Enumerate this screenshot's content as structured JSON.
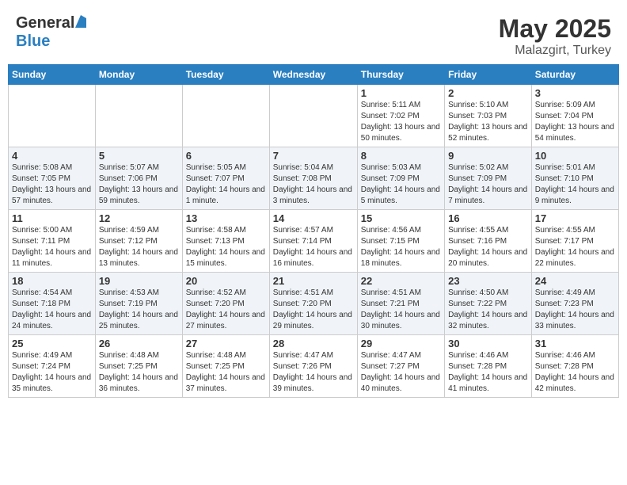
{
  "header": {
    "logo_general": "General",
    "logo_blue": "Blue",
    "title": "May 2025",
    "location": "Malazgirt, Turkey"
  },
  "weekdays": [
    "Sunday",
    "Monday",
    "Tuesday",
    "Wednesday",
    "Thursday",
    "Friday",
    "Saturday"
  ],
  "weeks": [
    [
      {
        "day": "",
        "sunrise": "",
        "sunset": "",
        "daylight": ""
      },
      {
        "day": "",
        "sunrise": "",
        "sunset": "",
        "daylight": ""
      },
      {
        "day": "",
        "sunrise": "",
        "sunset": "",
        "daylight": ""
      },
      {
        "day": "",
        "sunrise": "",
        "sunset": "",
        "daylight": ""
      },
      {
        "day": "1",
        "sunrise": "5:11 AM",
        "sunset": "7:02 PM",
        "daylight": "13 hours and 50 minutes."
      },
      {
        "day": "2",
        "sunrise": "5:10 AM",
        "sunset": "7:03 PM",
        "daylight": "13 hours and 52 minutes."
      },
      {
        "day": "3",
        "sunrise": "5:09 AM",
        "sunset": "7:04 PM",
        "daylight": "13 hours and 54 minutes."
      }
    ],
    [
      {
        "day": "4",
        "sunrise": "5:08 AM",
        "sunset": "7:05 PM",
        "daylight": "13 hours and 57 minutes."
      },
      {
        "day": "5",
        "sunrise": "5:07 AM",
        "sunset": "7:06 PM",
        "daylight": "13 hours and 59 minutes."
      },
      {
        "day": "6",
        "sunrise": "5:05 AM",
        "sunset": "7:07 PM",
        "daylight": "14 hours and 1 minute."
      },
      {
        "day": "7",
        "sunrise": "5:04 AM",
        "sunset": "7:08 PM",
        "daylight": "14 hours and 3 minutes."
      },
      {
        "day": "8",
        "sunrise": "5:03 AM",
        "sunset": "7:09 PM",
        "daylight": "14 hours and 5 minutes."
      },
      {
        "day": "9",
        "sunrise": "5:02 AM",
        "sunset": "7:09 PM",
        "daylight": "14 hours and 7 minutes."
      },
      {
        "day": "10",
        "sunrise": "5:01 AM",
        "sunset": "7:10 PM",
        "daylight": "14 hours and 9 minutes."
      }
    ],
    [
      {
        "day": "11",
        "sunrise": "5:00 AM",
        "sunset": "7:11 PM",
        "daylight": "14 hours and 11 minutes."
      },
      {
        "day": "12",
        "sunrise": "4:59 AM",
        "sunset": "7:12 PM",
        "daylight": "14 hours and 13 minutes."
      },
      {
        "day": "13",
        "sunrise": "4:58 AM",
        "sunset": "7:13 PM",
        "daylight": "14 hours and 15 minutes."
      },
      {
        "day": "14",
        "sunrise": "4:57 AM",
        "sunset": "7:14 PM",
        "daylight": "14 hours and 16 minutes."
      },
      {
        "day": "15",
        "sunrise": "4:56 AM",
        "sunset": "7:15 PM",
        "daylight": "14 hours and 18 minutes."
      },
      {
        "day": "16",
        "sunrise": "4:55 AM",
        "sunset": "7:16 PM",
        "daylight": "14 hours and 20 minutes."
      },
      {
        "day": "17",
        "sunrise": "4:55 AM",
        "sunset": "7:17 PM",
        "daylight": "14 hours and 22 minutes."
      }
    ],
    [
      {
        "day": "18",
        "sunrise": "4:54 AM",
        "sunset": "7:18 PM",
        "daylight": "14 hours and 24 minutes."
      },
      {
        "day": "19",
        "sunrise": "4:53 AM",
        "sunset": "7:19 PM",
        "daylight": "14 hours and 25 minutes."
      },
      {
        "day": "20",
        "sunrise": "4:52 AM",
        "sunset": "7:20 PM",
        "daylight": "14 hours and 27 minutes."
      },
      {
        "day": "21",
        "sunrise": "4:51 AM",
        "sunset": "7:20 PM",
        "daylight": "14 hours and 29 minutes."
      },
      {
        "day": "22",
        "sunrise": "4:51 AM",
        "sunset": "7:21 PM",
        "daylight": "14 hours and 30 minutes."
      },
      {
        "day": "23",
        "sunrise": "4:50 AM",
        "sunset": "7:22 PM",
        "daylight": "14 hours and 32 minutes."
      },
      {
        "day": "24",
        "sunrise": "4:49 AM",
        "sunset": "7:23 PM",
        "daylight": "14 hours and 33 minutes."
      }
    ],
    [
      {
        "day": "25",
        "sunrise": "4:49 AM",
        "sunset": "7:24 PM",
        "daylight": "14 hours and 35 minutes."
      },
      {
        "day": "26",
        "sunrise": "4:48 AM",
        "sunset": "7:25 PM",
        "daylight": "14 hours and 36 minutes."
      },
      {
        "day": "27",
        "sunrise": "4:48 AM",
        "sunset": "7:25 PM",
        "daylight": "14 hours and 37 minutes."
      },
      {
        "day": "28",
        "sunrise": "4:47 AM",
        "sunset": "7:26 PM",
        "daylight": "14 hours and 39 minutes."
      },
      {
        "day": "29",
        "sunrise": "4:47 AM",
        "sunset": "7:27 PM",
        "daylight": "14 hours and 40 minutes."
      },
      {
        "day": "30",
        "sunrise": "4:46 AM",
        "sunset": "7:28 PM",
        "daylight": "14 hours and 41 minutes."
      },
      {
        "day": "31",
        "sunrise": "4:46 AM",
        "sunset": "7:28 PM",
        "daylight": "14 hours and 42 minutes."
      }
    ]
  ]
}
